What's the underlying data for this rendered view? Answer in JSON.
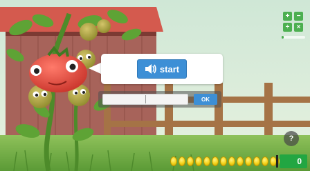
{
  "game": {
    "start_label": "start",
    "speaker_icon": "speaker-icon",
    "answer": {
      "value": "",
      "placeholder": ""
    },
    "ok_label": "OK"
  },
  "toolbar": {
    "operations": [
      {
        "symbol": "+",
        "icon": "plus-icon"
      },
      {
        "symbol": "−",
        "icon": "minus-icon"
      },
      {
        "symbol": "÷",
        "icon": "divide-icon"
      },
      {
        "symbol": "×",
        "icon": "times-icon"
      }
    ],
    "progress": 0.08
  },
  "help_label": "?",
  "coins_count": 15,
  "score": "0",
  "colors": {
    "accent_blue": "#3d8fd6",
    "accent_green": "#4caf50",
    "score_green": "#22a642",
    "coin_gold": "#f4d21a",
    "tomato_red": "#e0473c",
    "barn_red": "#9c3b35"
  }
}
